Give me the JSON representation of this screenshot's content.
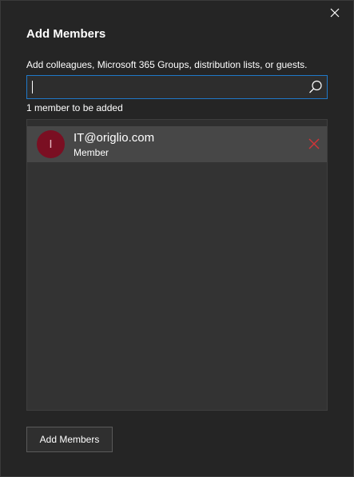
{
  "dialog": {
    "title": "Add Members",
    "instructions": "Add colleagues, Microsoft 365 Groups, distribution lists, or guests.",
    "count_text": "1 member to be added"
  },
  "search": {
    "value": "",
    "placeholder": ""
  },
  "members": [
    {
      "initial": "I",
      "email": "IT@origlio.com",
      "role": "Member"
    }
  ],
  "actions": {
    "add_label": "Add Members"
  },
  "colors": {
    "background": "#252525",
    "accent": "#1f78c8",
    "avatar": "#7a0f22",
    "remove": "#d13438"
  },
  "icons": {
    "close": "close-icon",
    "search": "search-icon",
    "remove": "close-icon"
  }
}
